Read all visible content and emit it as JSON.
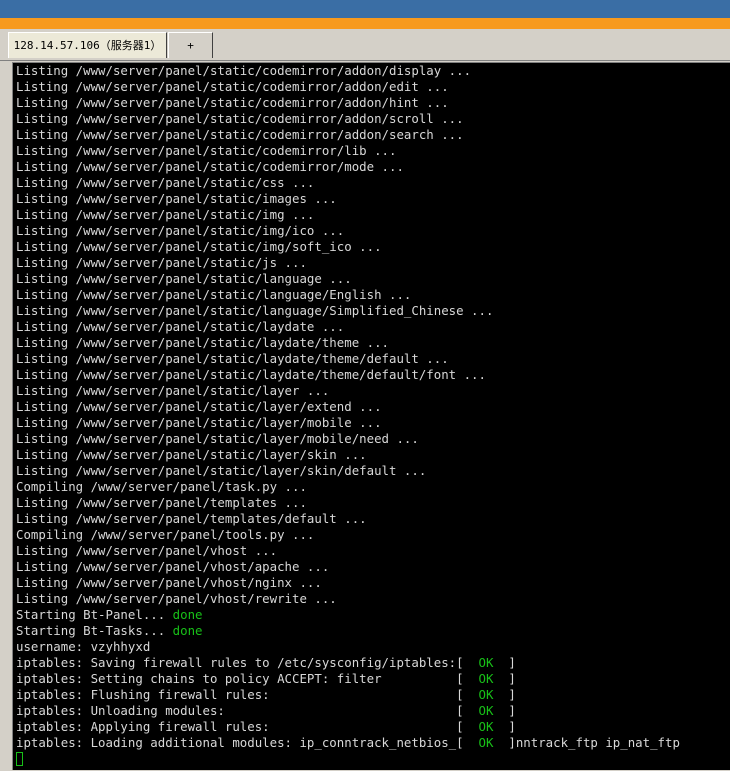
{
  "tabs": [
    {
      "label": "128.14.57.106（服务器1）"
    },
    {
      "label": "+"
    }
  ],
  "terminal": {
    "lines": [
      [
        {
          "t": "Listing /www/server/panel/static/codemirror/addon/display ..."
        }
      ],
      [
        {
          "t": "Listing /www/server/panel/static/codemirror/addon/edit ..."
        }
      ],
      [
        {
          "t": "Listing /www/server/panel/static/codemirror/addon/hint ..."
        }
      ],
      [
        {
          "t": "Listing /www/server/panel/static/codemirror/addon/scroll ..."
        }
      ],
      [
        {
          "t": "Listing /www/server/panel/static/codemirror/addon/search ..."
        }
      ],
      [
        {
          "t": "Listing /www/server/panel/static/codemirror/lib ..."
        }
      ],
      [
        {
          "t": "Listing /www/server/panel/static/codemirror/mode ..."
        }
      ],
      [
        {
          "t": "Listing /www/server/panel/static/css ..."
        }
      ],
      [
        {
          "t": "Listing /www/server/panel/static/images ..."
        }
      ],
      [
        {
          "t": "Listing /www/server/panel/static/img ..."
        }
      ],
      [
        {
          "t": "Listing /www/server/panel/static/img/ico ..."
        }
      ],
      [
        {
          "t": "Listing /www/server/panel/static/img/soft_ico ..."
        }
      ],
      [
        {
          "t": "Listing /www/server/panel/static/js ..."
        }
      ],
      [
        {
          "t": "Listing /www/server/panel/static/language ..."
        }
      ],
      [
        {
          "t": "Listing /www/server/panel/static/language/English ..."
        }
      ],
      [
        {
          "t": "Listing /www/server/panel/static/language/Simplified_Chinese ..."
        }
      ],
      [
        {
          "t": "Listing /www/server/panel/static/laydate ..."
        }
      ],
      [
        {
          "t": "Listing /www/server/panel/static/laydate/theme ..."
        }
      ],
      [
        {
          "t": "Listing /www/server/panel/static/laydate/theme/default ..."
        }
      ],
      [
        {
          "t": "Listing /www/server/panel/static/laydate/theme/default/font ..."
        }
      ],
      [
        {
          "t": "Listing /www/server/panel/static/layer ..."
        }
      ],
      [
        {
          "t": "Listing /www/server/panel/static/layer/extend ..."
        }
      ],
      [
        {
          "t": "Listing /www/server/panel/static/layer/mobile ..."
        }
      ],
      [
        {
          "t": "Listing /www/server/panel/static/layer/mobile/need ..."
        }
      ],
      [
        {
          "t": "Listing /www/server/panel/static/layer/skin ..."
        }
      ],
      [
        {
          "t": "Listing /www/server/panel/static/layer/skin/default ..."
        }
      ],
      [
        {
          "t": "Compiling /www/server/panel/task.py ..."
        }
      ],
      [
        {
          "t": "Listing /www/server/panel/templates ..."
        }
      ],
      [
        {
          "t": "Listing /www/server/panel/templates/default ..."
        }
      ],
      [
        {
          "t": "Compiling /www/server/panel/tools.py ..."
        }
      ],
      [
        {
          "t": "Listing /www/server/panel/vhost ..."
        }
      ],
      [
        {
          "t": "Listing /www/server/panel/vhost/apache ..."
        }
      ],
      [
        {
          "t": "Listing /www/server/panel/vhost/nginx ..."
        }
      ],
      [
        {
          "t": "Listing /www/server/panel/vhost/rewrite ..."
        }
      ],
      [
        {
          "t": "Starting Bt-Panel... "
        },
        {
          "t": "done",
          "c": "green"
        }
      ],
      [
        {
          "t": "Starting Bt-Tasks... "
        },
        {
          "t": "done",
          "c": "green"
        }
      ],
      [
        {
          "t": "username: vzyhhyxd"
        }
      ],
      [
        {
          "t": "iptables: Saving firewall rules to /etc/sysconfig/iptables:[  "
        },
        {
          "t": "OK",
          "c": "green"
        },
        {
          "t": "  ]"
        }
      ],
      [
        {
          "t": "iptables: Setting chains to policy ACCEPT: filter          [  "
        },
        {
          "t": "OK",
          "c": "green"
        },
        {
          "t": "  ]"
        }
      ],
      [
        {
          "t": "iptables: Flushing firewall rules:                         [  "
        },
        {
          "t": "OK",
          "c": "green"
        },
        {
          "t": "  ]"
        }
      ],
      [
        {
          "t": "iptables: Unloading modules:                               [  "
        },
        {
          "t": "OK",
          "c": "green"
        },
        {
          "t": "  ]"
        }
      ],
      [
        {
          "t": "iptables: Applying firewall rules:                         [  "
        },
        {
          "t": "OK",
          "c": "green"
        },
        {
          "t": "  ]"
        }
      ],
      [
        {
          "t": "iptables: Loading additional modules: ip_conntrack_netbios_[  "
        },
        {
          "t": "OK",
          "c": "green"
        },
        {
          "t": "  ]nntrack_ftp ip_nat_ftp"
        }
      ]
    ]
  },
  "colors": {
    "terminal_bg": "#000000",
    "terminal_text": "#d8d8d8",
    "ok_green": "#18c018",
    "accent_orange": "#f79a1e",
    "desktop_blue": "#3a6ea5"
  }
}
